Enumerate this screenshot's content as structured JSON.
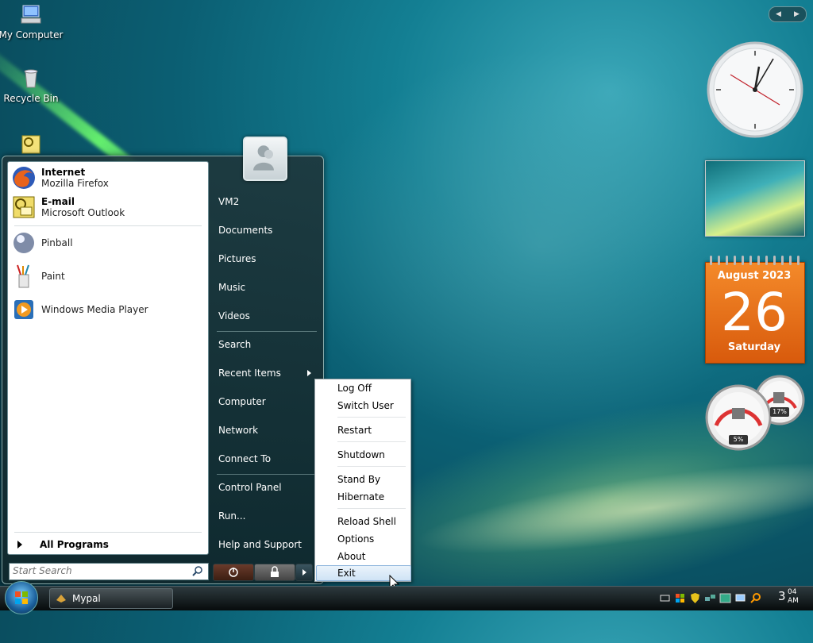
{
  "desktop": {
    "icons": [
      {
        "label": "My Computer"
      },
      {
        "label": "Recycle Bin"
      }
    ]
  },
  "start_menu": {
    "pinned": [
      {
        "title": "Internet",
        "subtitle": "Mozilla Firefox"
      },
      {
        "title": "E-mail",
        "subtitle": "Microsoft Outlook"
      }
    ],
    "recent": [
      {
        "label": "Pinball"
      },
      {
        "label": "Paint"
      },
      {
        "label": "Windows Media Player"
      }
    ],
    "all_programs": "All Programs",
    "search_placeholder": "Start Search",
    "right_items": {
      "user": "VM2",
      "documents": "Documents",
      "pictures": "Pictures",
      "music": "Music",
      "videos": "Videos",
      "search": "Search",
      "recent_items": "Recent Items",
      "computer": "Computer",
      "network": "Network",
      "connect_to": "Connect To",
      "control_panel": "Control Panel",
      "run": "Run...",
      "help": "Help and Support"
    }
  },
  "context_menu": {
    "log_off": "Log Off",
    "switch_user": "Switch User",
    "restart": "Restart",
    "shutdown": "Shutdown",
    "stand_by": "Stand By",
    "hibernate": "Hibernate",
    "reload_shell": "Reload Shell",
    "options": "Options",
    "about": "About",
    "exit": "Exit"
  },
  "gadgets": {
    "calendar": {
      "month_year": "August 2023",
      "day": "26",
      "weekday": "Saturday"
    },
    "cpu_meter": {
      "cpu": "5%",
      "memory": "17%"
    }
  },
  "taskbar": {
    "task_label": "Mypal",
    "clock_hour": "3",
    "clock_minute": "04",
    "clock_ampm": "AM"
  },
  "colors": {
    "calendar_orange": "#e8701a",
    "menu_highlight": "#cfe3f5"
  }
}
